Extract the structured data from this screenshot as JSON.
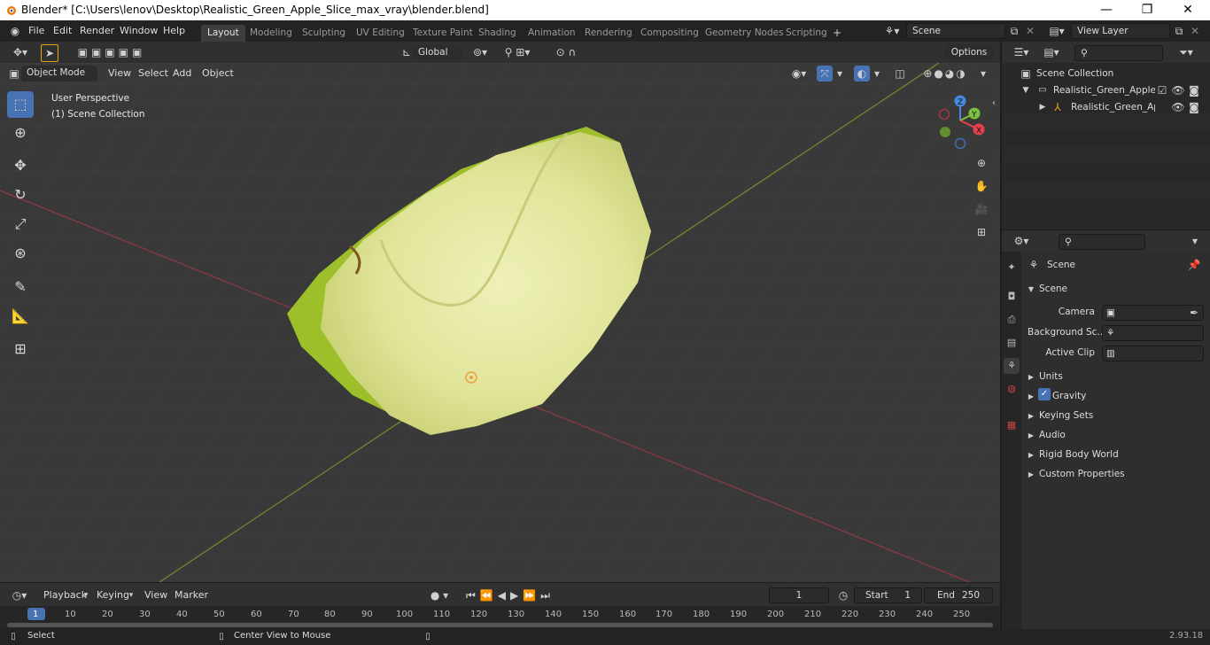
{
  "window": {
    "title": "Blender* [C:\\Users\\lenov\\Desktop\\Realistic_Green_Apple_Slice_max_vray\\blender.blend]",
    "minimize": "—",
    "maximize": "❐",
    "close": "✕"
  },
  "menu": {
    "file": "File",
    "edit": "Edit",
    "render": "Render",
    "window": "Window",
    "help": "Help"
  },
  "workspaces": [
    "Layout",
    "Modeling",
    "Sculpting",
    "UV Editing",
    "Texture Paint",
    "Shading",
    "Animation",
    "Rendering",
    "Compositing",
    "Geometry Nodes",
    "Scripting"
  ],
  "scene_field": "Scene",
  "view_layer_field": "View Layer",
  "viewport": {
    "orientation": "Global",
    "options": "Options",
    "mode": "Object Mode",
    "menu_view": "View",
    "menu_select": "Select",
    "menu_add": "Add",
    "menu_object": "Object",
    "perspective_label": "User Perspective",
    "collection_label": "(1) Scene Collection",
    "gizmo_x": "X",
    "gizmo_y": "Y",
    "gizmo_z": "Z"
  },
  "outliner": {
    "root": "Scene Collection",
    "item1": "Realistic_Green_Apple_Slic",
    "item2": "Realistic_Green_Apple"
  },
  "properties": {
    "context": "Scene",
    "panel": "Scene",
    "camera_label": "Camera",
    "background_label": "Background Sc...",
    "clip_label": "Active Clip",
    "sections": [
      "Units",
      "Gravity",
      "Keying Sets",
      "Audio",
      "Rigid Body World",
      "Custom Properties"
    ]
  },
  "timeline": {
    "playback": "Playback",
    "keying": "Keying",
    "view": "View",
    "marker": "Marker",
    "current_frame": "1",
    "start_label": "Start",
    "start_value": "1",
    "end_label": "End",
    "end_value": "250",
    "ticks": [
      "1",
      "10",
      "20",
      "30",
      "40",
      "50",
      "60",
      "70",
      "80",
      "90",
      "100",
      "110",
      "120",
      "130",
      "140",
      "150",
      "160",
      "170",
      "180",
      "190",
      "200",
      "210",
      "220",
      "230",
      "240",
      "250"
    ]
  },
  "status": {
    "select": "Select",
    "center": "Center View to Mouse",
    "version": "2.93.18"
  },
  "colors": {
    "accent": "#4772b3",
    "active_tab": "#3d3d3d",
    "x_axis": "#e6414d",
    "y_axis": "#7fbf3f",
    "z_axis": "#4788e0"
  }
}
